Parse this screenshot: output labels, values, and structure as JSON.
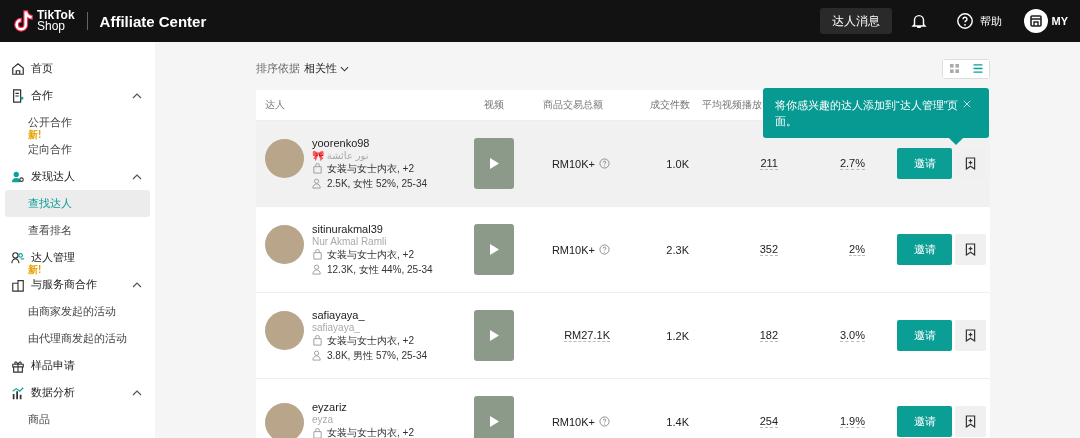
{
  "header": {
    "logo_top": "TikTok",
    "logo_bottom": "Shop",
    "title": "Affiliate Center",
    "messages_button": "达人消息",
    "help": "帮助",
    "account": "MY"
  },
  "sidebar": {
    "items": [
      {
        "label": "首页"
      },
      {
        "label": "合作",
        "expanded": true,
        "children": [
          {
            "label": "公开合作",
            "badge": "新!",
            "selected": false
          },
          {
            "label": "定向合作",
            "selected": false
          }
        ]
      },
      {
        "label": "发现达人",
        "expanded": true,
        "children": [
          {
            "label": "查找达人",
            "selected": true
          },
          {
            "label": "查看排名",
            "selected": false
          }
        ]
      },
      {
        "label": "达人管理",
        "badge": "新!"
      },
      {
        "label": "与服务商合作",
        "expanded": true,
        "children": [
          {
            "label": "由商家发起的活动",
            "selected": false
          },
          {
            "label": "由代理商发起的活动",
            "selected": false
          }
        ]
      },
      {
        "label": "样品申请"
      },
      {
        "label": "数据分析",
        "expanded": true,
        "children": [
          {
            "label": "商品",
            "selected": false
          }
        ]
      }
    ]
  },
  "sort": {
    "label": "排序依据",
    "value": "相关性"
  },
  "view_toggle": [
    {
      "kind": "grid",
      "selected": false
    },
    {
      "kind": "list",
      "selected": true
    }
  ],
  "table": {
    "columns": [
      "达人",
      "视频",
      "商品交易总额",
      "成交件数",
      "平均视频播放"
    ],
    "rows": [
      {
        "highlighted": true,
        "username": "yoorenko98",
        "display_name": "🎀 نور عائشة",
        "category": "女装与女士内衣, +2",
        "audience": "2.5K, 女性 52%, 25-34",
        "gmv": "RM10K+",
        "gmv_help": true,
        "units": "1.0K",
        "views": "211",
        "rate": "2.7%",
        "invite": "邀请"
      },
      {
        "highlighted": false,
        "username": "sitinurakmal39",
        "display_name": "Nur Akmal Ramli",
        "category": "女装与女士内衣, +2",
        "audience": "12.3K, 女性 44%, 25-34",
        "gmv": "RM10K+",
        "gmv_help": true,
        "units": "2.3K",
        "views": "352",
        "rate": "2%",
        "invite": "邀请"
      },
      {
        "highlighted": false,
        "username": "safiayaya_",
        "display_name": "safiayaya_",
        "category": "女装与女士内衣, +2",
        "audience": "3.8K, 男性 57%, 25-34",
        "gmv": "RM27.1K",
        "gmv_help": false,
        "units": "1.2K",
        "views": "182",
        "rate": "3.0%",
        "invite": "邀请"
      },
      {
        "highlighted": false,
        "username": "eyzariz",
        "display_name": "eyza",
        "category": "女装与女士内衣, +2",
        "gmv": "RM10K+",
        "gmv_help": true,
        "units": "1.4K",
        "views": "254",
        "rate": "1.9%",
        "invite": "邀请"
      }
    ]
  },
  "tooltip": {
    "text": "将你感兴趣的达人添加到“达人管理”页面。"
  }
}
